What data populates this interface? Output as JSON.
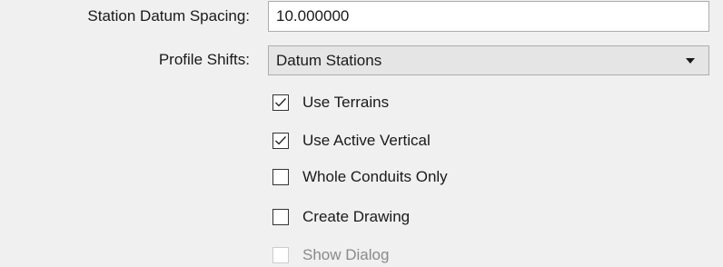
{
  "form": {
    "station_datum_spacing": {
      "label": "Station Datum Spacing:",
      "value": "10.000000"
    },
    "profile_shifts": {
      "label": "Profile Shifts:",
      "selected": "Datum Stations"
    },
    "options": [
      {
        "label": "Use Terrains",
        "checked": true,
        "enabled": true
      },
      {
        "label": "Use Active Vertical",
        "checked": true,
        "enabled": true
      },
      {
        "label": "Whole Conduits Only",
        "checked": false,
        "enabled": true
      },
      {
        "label": "Create Drawing",
        "checked": false,
        "enabled": true
      },
      {
        "label": "Show Dialog",
        "checked": false,
        "enabled": false
      }
    ]
  },
  "colors": {
    "background": "#f0f0f0",
    "dropdown_bg": "#e5e5e5",
    "border": "#adadad",
    "disabled_text": "#8a8a8a"
  },
  "icons": {
    "checkmark": "check-icon",
    "dropdown": "chevron-down-icon"
  }
}
